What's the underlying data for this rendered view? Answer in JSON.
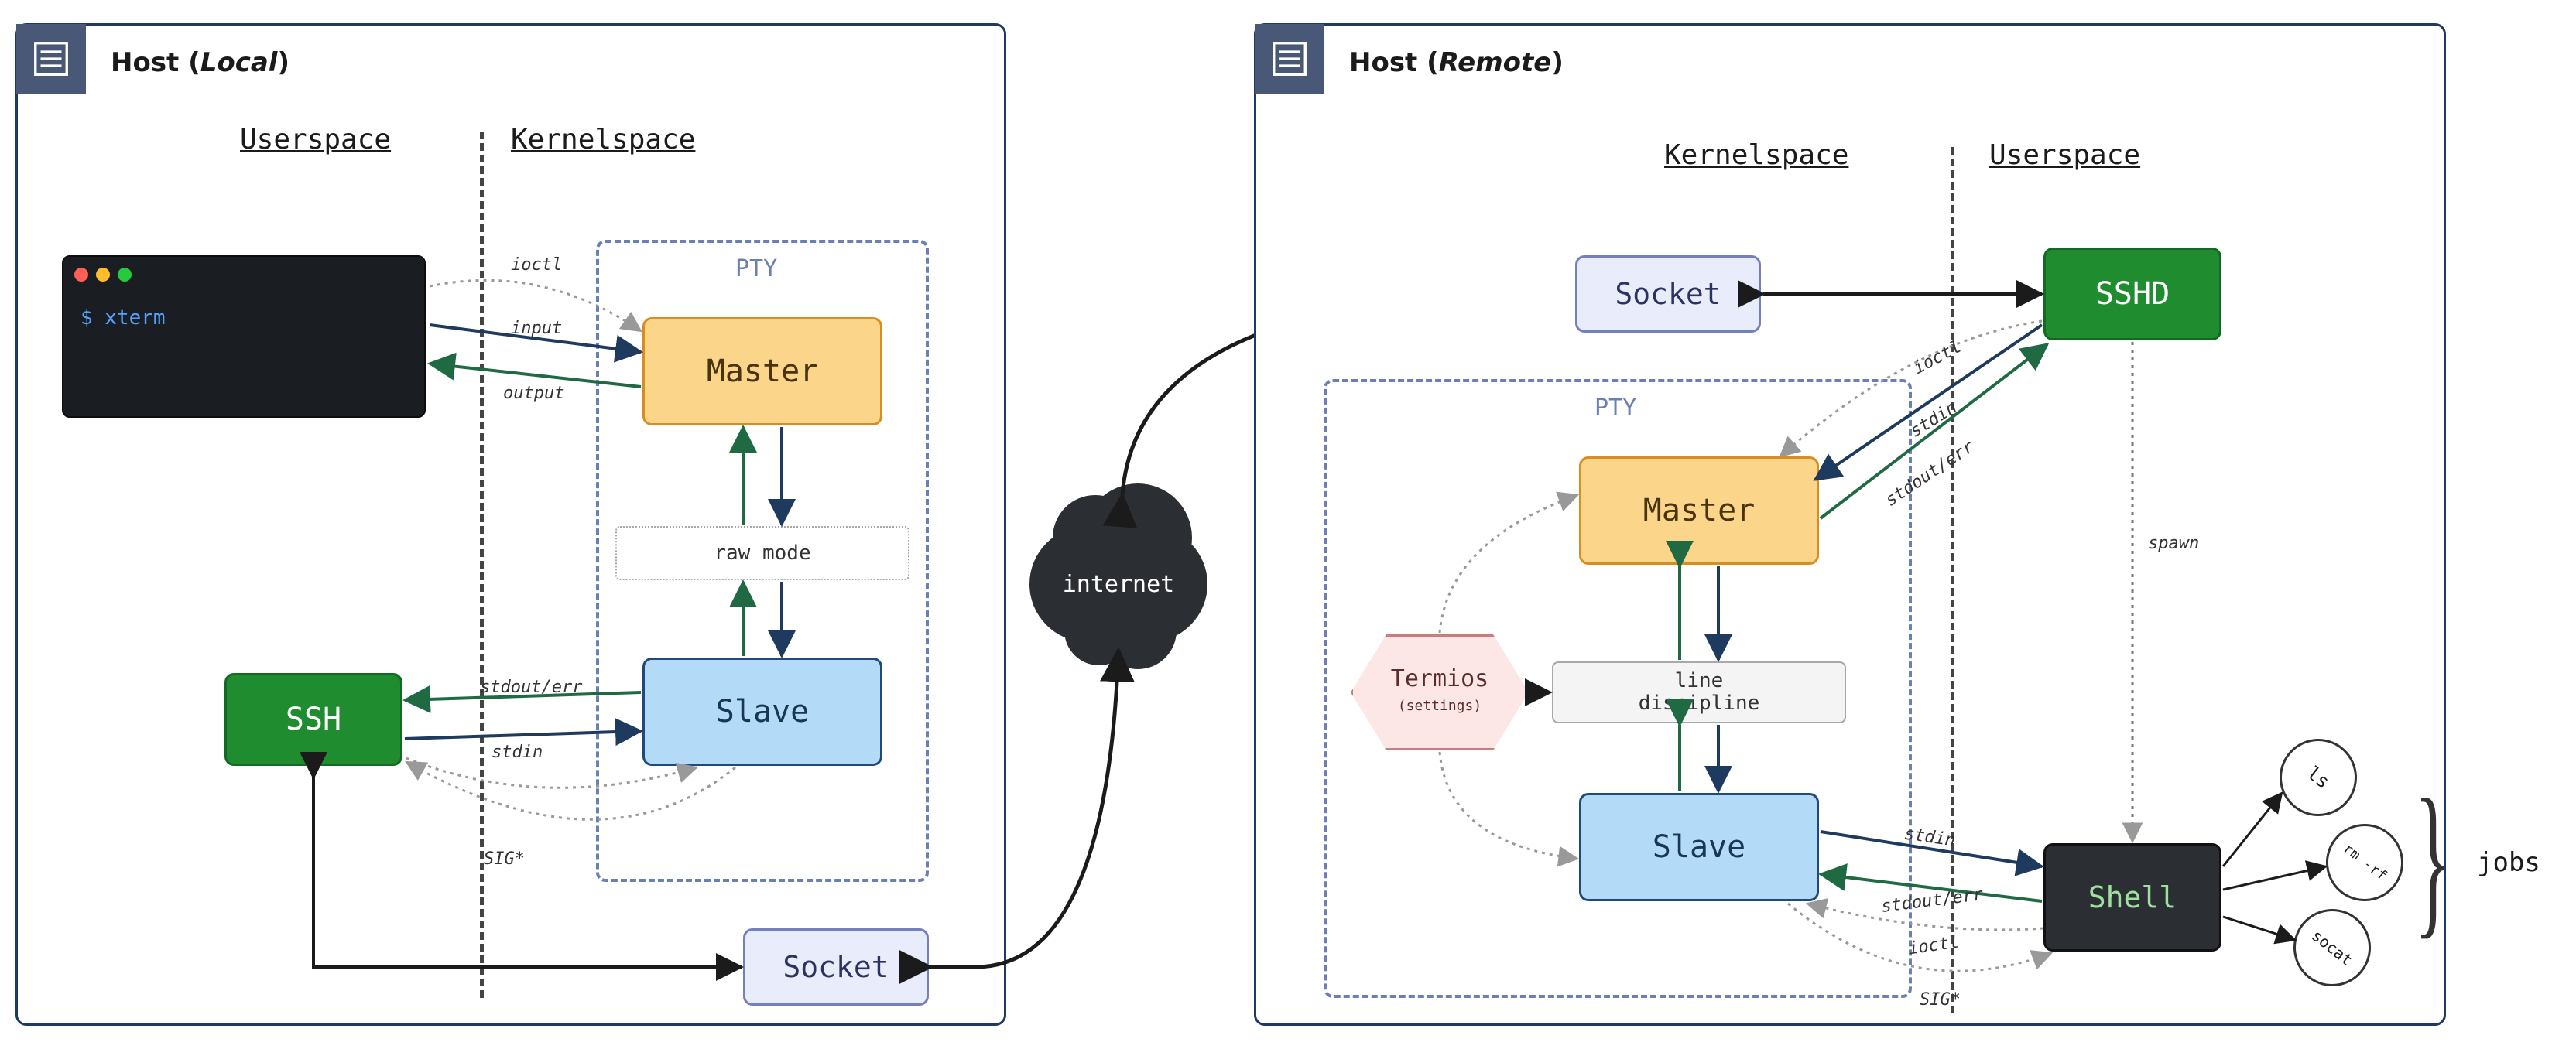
{
  "local": {
    "title_prefix": "Host (",
    "title_em": "Local",
    "title_suffix": ")",
    "userspace": "Userspace",
    "kernelspace": "Kernelspace",
    "pty_label": "PTY",
    "master": "Master",
    "slave": "Slave",
    "raw_mode": "raw mode",
    "ssh": "SSH",
    "socket": "Socket",
    "terminal_cmd": "$ xterm",
    "labels": {
      "ioctl": "ioctl",
      "input": "input",
      "output": "output",
      "stdout_err": "stdout/err",
      "stdin": "stdin",
      "sig": "SIG*"
    }
  },
  "remote": {
    "title_prefix": "Host (",
    "title_em": "Remote",
    "title_suffix": ")",
    "userspace": "Userspace",
    "kernelspace": "Kernelspace",
    "pty_label": "PTY",
    "master": "Master",
    "slave": "Slave",
    "line_discipline": "line\ndiscipline",
    "termios_title": "Termios",
    "termios_sub": "(settings)",
    "sshd": "SSHD",
    "shell": "Shell",
    "socket": "Socket",
    "labels": {
      "ioctl": "ioctl",
      "stdin": "stdin",
      "stdout_err": "stdout/err",
      "spawn": "spawn",
      "sig": "SIG*"
    }
  },
  "cloud": "internet",
  "jobs": {
    "label": "jobs",
    "items": [
      "ls",
      "rm -rf",
      "socat"
    ]
  }
}
